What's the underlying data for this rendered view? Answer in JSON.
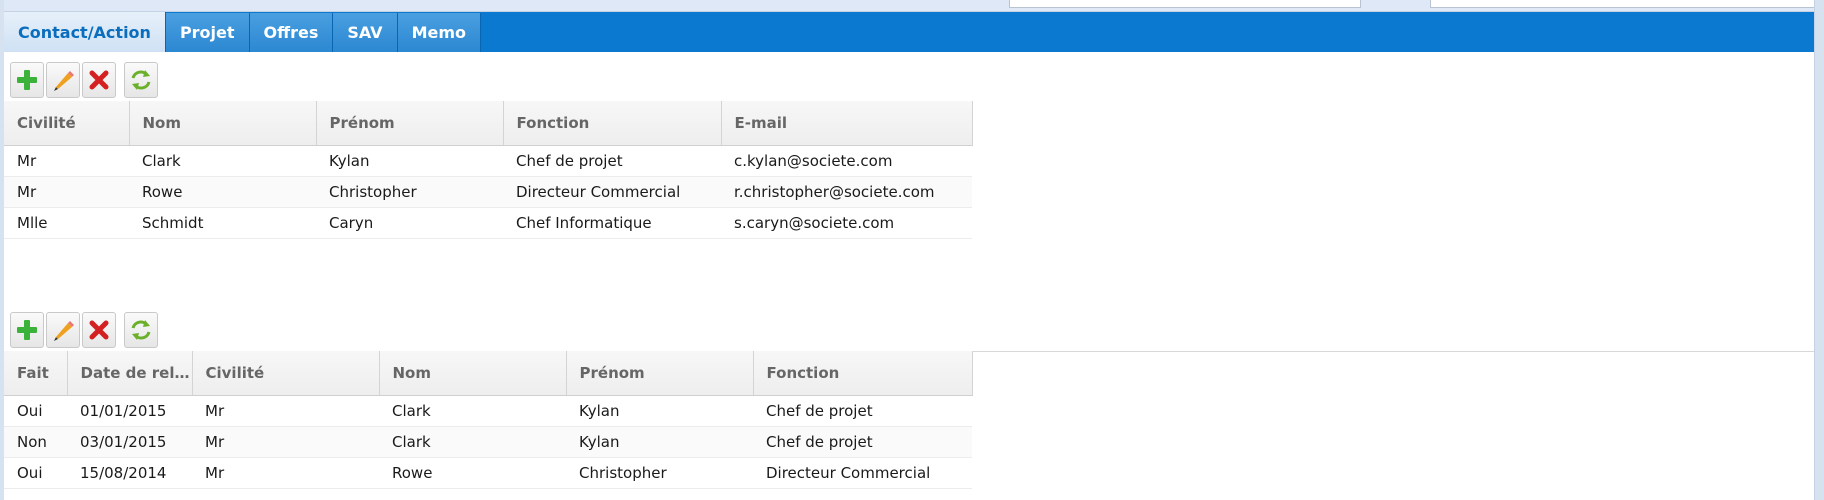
{
  "tabs": [
    {
      "label": "Contact/Action",
      "active": true
    },
    {
      "label": "Projet",
      "active": false
    },
    {
      "label": "Offres",
      "active": false
    },
    {
      "label": "SAV",
      "active": false
    },
    {
      "label": "Memo",
      "active": false
    }
  ],
  "colors": {
    "tabbar": "#0a79cf",
    "active_tab_text": "#0a6dbd",
    "add_icon": "#3bb33b",
    "delete_icon": "#d42020"
  },
  "toolbar_icons": [
    "add-icon",
    "edit-icon",
    "delete-icon",
    "refresh-icon"
  ],
  "contacts": {
    "columns": [
      "Civilité",
      "Nom",
      "Prénom",
      "Fonction",
      "E-mail"
    ],
    "rows": [
      [
        "Mr",
        "Clark",
        "Kylan",
        "Chef de projet",
        "c.kylan@societe.com"
      ],
      [
        "Mr",
        "Rowe",
        "Christopher",
        "Directeur Commercial",
        "r.christopher@societe.com"
      ],
      [
        "Mlle",
        "Schmidt",
        "Caryn",
        "Chef Informatique",
        "s.caryn@societe.com"
      ]
    ]
  },
  "actions": {
    "columns": [
      "Fait",
      "Date de rel...",
      "Civilité",
      "Nom",
      "Prénom",
      "Fonction"
    ],
    "rows": [
      [
        "Oui",
        "01/01/2015",
        "Mr",
        "Clark",
        "Kylan",
        "Chef de projet"
      ],
      [
        "Non",
        "03/01/2015",
        "Mr",
        "Clark",
        "Kylan",
        "Chef de projet"
      ],
      [
        "Oui",
        "15/08/2014",
        "Mr",
        "Rowe",
        "Christopher",
        "Directeur Commercial"
      ]
    ]
  }
}
